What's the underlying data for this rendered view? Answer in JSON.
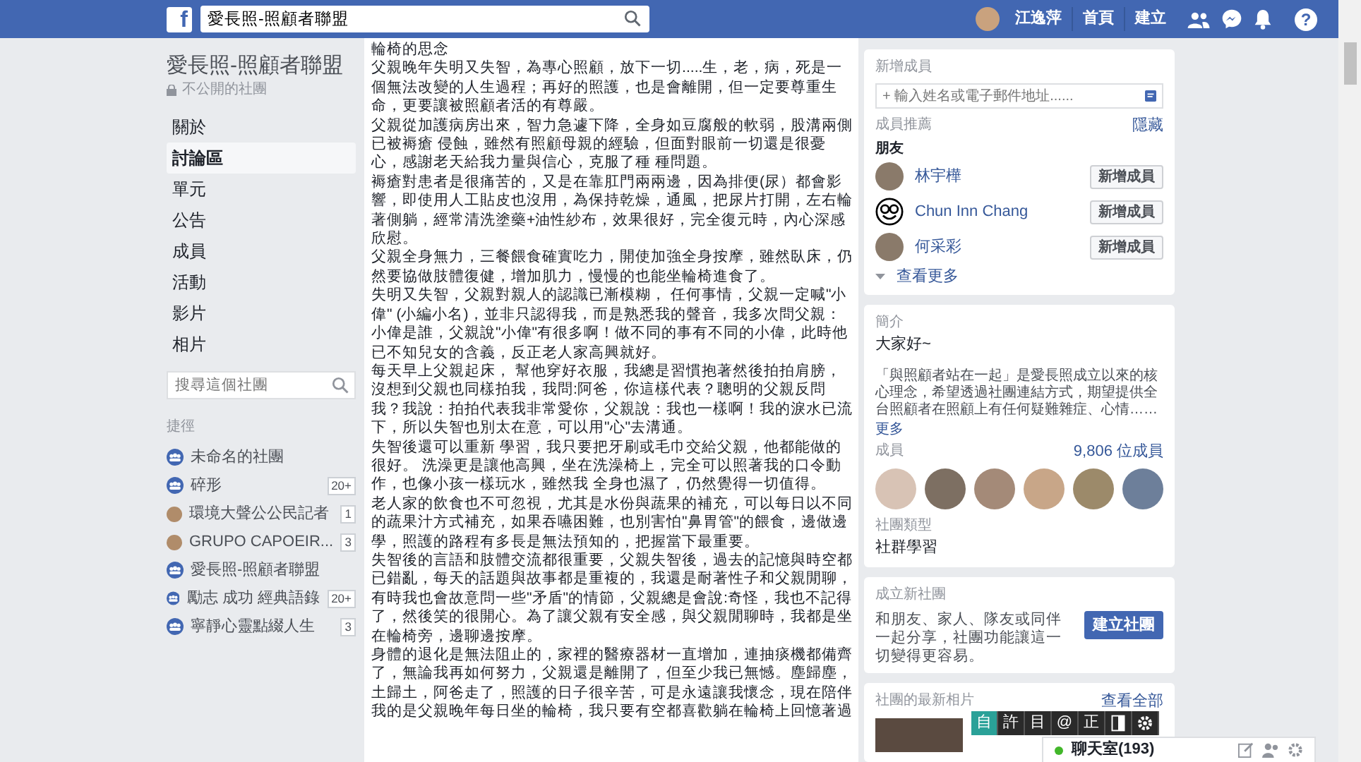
{
  "topbar": {
    "logo": "f",
    "search_value": "愛長照-照顧者聯盟",
    "user": "江逸萍",
    "links": [
      "首頁",
      "建立"
    ],
    "help": "?"
  },
  "sidebar": {
    "group_title": "愛長照-照顧者聯盟",
    "privacy": "不公開的社團",
    "nav": [
      {
        "label": "關於",
        "selected": false
      },
      {
        "label": "討論區",
        "selected": true
      },
      {
        "label": "單元",
        "selected": false
      },
      {
        "label": "公告",
        "selected": false
      },
      {
        "label": "成員",
        "selected": false
      },
      {
        "label": "活動",
        "selected": false
      },
      {
        "label": "影片",
        "selected": false
      },
      {
        "label": "相片",
        "selected": false
      }
    ],
    "search_placeholder": "搜尋這個社團",
    "shortcuts_heading": "捷徑",
    "shortcuts": [
      {
        "label": "未命名的社團",
        "kind": "group"
      },
      {
        "label": "碎形",
        "kind": "group",
        "count": "20+"
      },
      {
        "label": "環境大聲公公民記者",
        "kind": "photo",
        "count": "1"
      },
      {
        "label": "GRUPO CAPOEIR...",
        "kind": "photo",
        "count": "3"
      },
      {
        "label": "愛長照-照顧者聯盟",
        "kind": "group"
      },
      {
        "label": "勵志 成功 經典語錄",
        "kind": "group",
        "count": "20+"
      },
      {
        "label": "寧靜心靈點綴人生",
        "kind": "group",
        "count": "3"
      }
    ]
  },
  "post": {
    "title": "輪椅的思念",
    "paragraphs": [
      "父親晚年失明又失智，為專心照顧，放下一切.....生，老，病，死是一個無法改變的人生過程；再好的照護，也是會離開，但一定要尊重生命，更要讓被照顧者活的有尊嚴。",
      "父親從加護病房出來，智力急遽下降，全身如豆腐般的軟弱，股溝兩側已被褥瘡 侵蝕，雖然有照顧母親的經驗，但面對眼前一切還是很憂心，感謝老天給我力量與信心，克服了種 種問題。",
      "褥瘡對患者是很痛苦的，又是在靠肛門兩兩邊，因為排便(尿）都會影響，即使用人工貼皮也沒用，為保持乾燥，通風，把尿片打開，左右輪著側躺，經常清洗塗藥+油性紗布，效果很好，完全復元時，內心深感欣慰。",
      "父親全身無力，三餐餵食確實吃力，開使加強全身按摩，雖然臥床，仍然要協做肢體復健，增加肌力，慢慢的也能坐輪椅進食了。",
      "失明又失智，父親對親人的認識已漸模糊， 任何事情，父親一定喊\"小偉\" (小編小名)，並非只認得我，而是熟悉我的聲音，我多次問父親：小偉是誰，父親說\"小偉\"有很多啊！做不同的事有不同的小偉，此時他已不知兒女的含義，反正老人家高興就好。",
      "每天早上父親起床， 幫他穿好衣服，我總是習慣抱著然後拍拍肩膀，沒想到父親也同樣拍我，我問:阿爸，你這樣代表？聰明的父親反問我？我說：拍拍代表我非常愛你，父親說：我也一樣啊！我的淚水已流下，所以失智也別太在意，可以用\"心\"去溝通。",
      "失智後還可以重新 學習，我只要把牙刷或毛巾交給父親，他都能做的很好。 洗澡更是讓他高興，坐在洗澡椅上，完全可以照著我的口令動作，也像小孩一樣玩水，雖然我 全身也濕了，仍然覺得一切值得。",
      "老人家的飲食也不可忽視，尤其是水份與蔬果的補充，可以每日以不同的蔬果汁方式補充，如果吞嚥困難，也別害怕\"鼻胃管\"的餵食，邊做邊學，照護的路程有多長是無法預知的，把握當下最重要。",
      "失智後的言語和肢體交流都很重要，父親失智後，過去的記憶與時空都已錯亂，每天的話題與故事都是重複的，我還是耐著性子和父親閒聊，有時我也會故意問一些\"矛盾\"的情節，父親總是會說:奇怪，我也不記得了，然後笑的很開心。為了讓父親有安全感，與父親閒聊時，我都是坐在輪椅旁，邊聊邊按摩。",
      "身體的退化是無法阻止的，家裡的醫療器材一直增加，連抽痰機都備齊了，無論我再如何努力，父親還是離開了，但至少我已無憾。塵歸塵，土歸土，阿爸走了，照護的日子很辛苦，可是永遠讓我懷念，現在陪伴我的是父親晚年每日坐的輪椅，我只要有空都喜歡躺在輪椅上回憶著過"
    ]
  },
  "add_members": {
    "heading": "新增成員",
    "placeholder": "+ 輸入姓名或電子郵件地址......",
    "suggest_heading": "成員推薦",
    "hide_link": "隱藏",
    "friends_heading": "朋友",
    "friends": [
      {
        "name": "林宇樺",
        "kind": "photo",
        "button": "新增成員"
      },
      {
        "name": "Chun Inn Chang",
        "kind": "cartoon",
        "button": "新增成員"
      },
      {
        "name": "何采彩",
        "kind": "photo",
        "button": "新增成員"
      }
    ],
    "see_more": "查看更多"
  },
  "about": {
    "heading": "簡介",
    "greeting": "大家好~",
    "description": "「與照顧者站在一起」是愛長照成立以來的核心理念，希望透過社團連結方式，期望提供全台照顧者在照顧上有任何疑難雜症、心情……",
    "more": "更多",
    "members_heading": "成員",
    "members_count": "9,806 位成員",
    "type_heading": "社團類型",
    "type": "社群學習"
  },
  "create_group": {
    "heading": "成立新社團",
    "text": "和朋友、家人、隊友或同伴一起分享，社團功能讓這一切變得更容易。",
    "button": "建立社團"
  },
  "recent_photos": {
    "heading": "社團的最新相片",
    "see_all": "查看全部"
  },
  "ime_toolbar": {
    "keys": [
      "自",
      "許",
      "目",
      "@",
      "正"
    ]
  },
  "chat": {
    "label": "聊天室(193)",
    "online": true
  }
}
